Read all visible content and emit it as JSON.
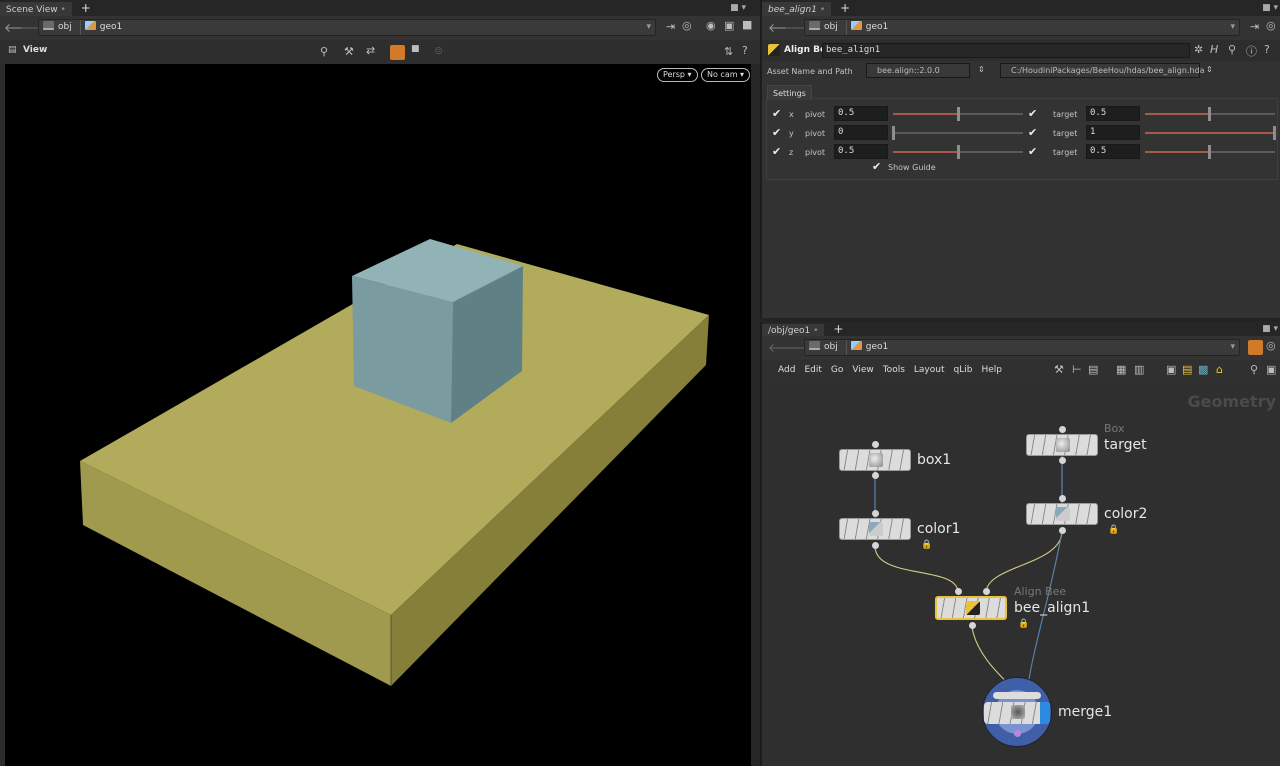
{
  "scene_view": {
    "tab_label": "Scene View",
    "path": [
      "obj",
      "geo1"
    ],
    "view_title": "View",
    "camera_menu": "Persp",
    "cam_menu": "No cam"
  },
  "params_pane": {
    "tab_label": "bee_align1",
    "path": [
      "obj",
      "geo1"
    ],
    "node_type_label": "Align Bee",
    "node_name": "bee_align1",
    "asset_label": "Asset Name and Path",
    "asset_name": "bee.align::2.0.0",
    "asset_path": "C:/HoudiniPackages/BeeHou/hdas/bee_align.hda",
    "settings_tab": "Settings",
    "show_guide_label": "Show Guide",
    "show_guide": true,
    "rows": [
      {
        "axis": "x",
        "pivot_label": "pivot",
        "pivot": "0.5",
        "target_label": "target",
        "target": "0.5",
        "pivot_frac": 0.5,
        "target_frac": 0.5
      },
      {
        "axis": "y",
        "pivot_label": "pivot",
        "pivot": "0",
        "target_label": "target",
        "target": "1",
        "pivot_frac": 0,
        "target_frac": 1
      },
      {
        "axis": "z",
        "pivot_label": "pivot",
        "pivot": "0.5",
        "target_label": "target",
        "target": "0.5",
        "pivot_frac": 0.5,
        "target_frac": 0.5
      }
    ]
  },
  "network_pane": {
    "tab_label": "/obj/geo1",
    "path": [
      "obj",
      "geo1"
    ],
    "menu": [
      "Add",
      "Edit",
      "Go",
      "View",
      "Tools",
      "Layout",
      "qLib",
      "Help"
    ],
    "context_label": "Geometry",
    "nodes": {
      "box1": {
        "name": "box1"
      },
      "target": {
        "name": "target",
        "type": "Box"
      },
      "color1": {
        "name": "color1"
      },
      "color2": {
        "name": "color2"
      },
      "bee_align1": {
        "name": "bee_align1",
        "type": "Align Bee"
      },
      "merge1": {
        "name": "merge1"
      }
    }
  },
  "colors": {
    "box_plane": "#c2bb6e",
    "cube": "#7fa3a6",
    "selected_node": "#e8c23a",
    "merge_ring": "#3f5fa8",
    "accent_orange": "#d07a2a"
  }
}
